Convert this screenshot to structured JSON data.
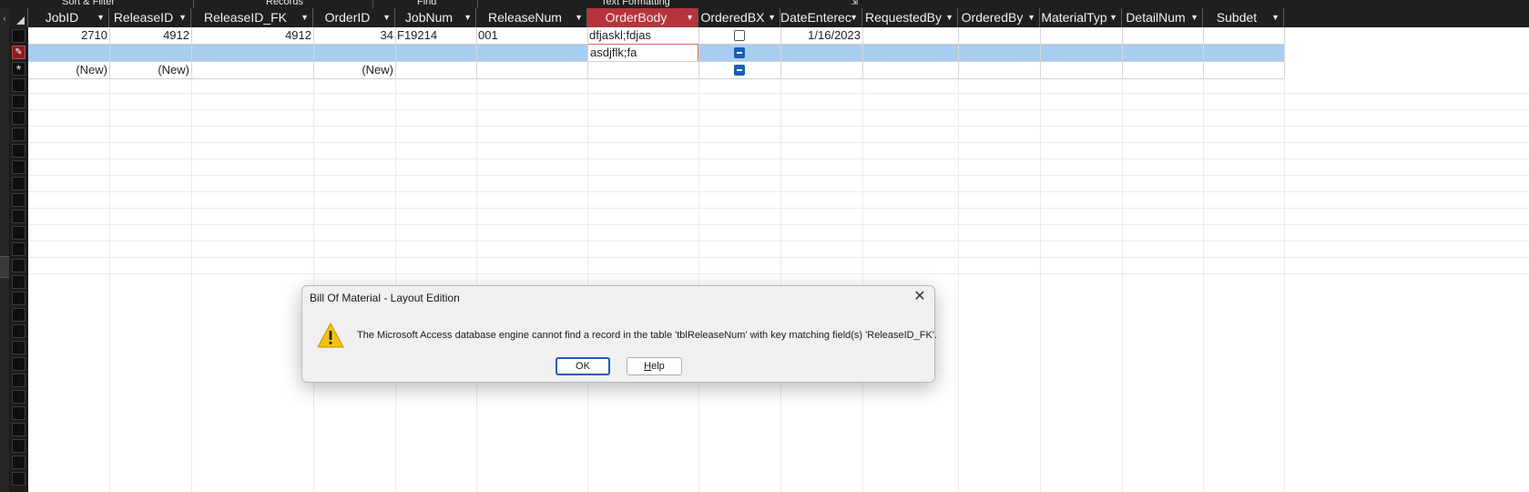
{
  "ribbon": {
    "groups": [
      "Sort & Filter",
      "Records",
      "Find",
      "Text Formatting"
    ]
  },
  "columns": [
    {
      "name": "JobID"
    },
    {
      "name": "ReleaseID"
    },
    {
      "name": "ReleaseID_FK"
    },
    {
      "name": "OrderID"
    },
    {
      "name": "JobNum"
    },
    {
      "name": "ReleaseNum"
    },
    {
      "name": "OrderBody",
      "active": true
    },
    {
      "name": "OrderedBX"
    },
    {
      "name": "DateEnterec"
    },
    {
      "name": "RequestedBy"
    },
    {
      "name": "OrderedBy"
    },
    {
      "name": "MaterialTyp"
    },
    {
      "name": "DetailNum"
    },
    {
      "name": "Subdet"
    }
  ],
  "rows": [
    {
      "JobID": "2710",
      "ReleaseID": "4912",
      "ReleaseID_FK": "4912",
      "OrderID": "34",
      "JobNum": "F19214",
      "ReleaseNum": "001",
      "OrderBody": "dfjaskl;fdjas",
      "OrderedBX": "unchecked",
      "DateEnterec": "1/16/2023"
    },
    {
      "OrderBody": "asdjflk;fa",
      "OrderedBX": "mixed",
      "editing": true
    },
    {
      "JobID": "(New)",
      "ReleaseID": "(New)",
      "OrderID": "(New)",
      "OrderedBX": "mixed",
      "new_record": true
    }
  ],
  "dialog": {
    "title": "Bill Of Material - Layout Edition",
    "icon": "warning-icon",
    "message": "The Microsoft Access database engine cannot find a record in the table 'tblReleaseNum' with key matching field(s) 'ReleaseID_FK'.",
    "ok_label": "OK",
    "help_label_underlined": "H",
    "help_label_rest": "elp"
  },
  "colors": {
    "header_bg": "#1f1f1f",
    "active_header": "#b5343c",
    "selected_row": "#a8cdf0",
    "accent_blue": "#1a5fb4"
  }
}
